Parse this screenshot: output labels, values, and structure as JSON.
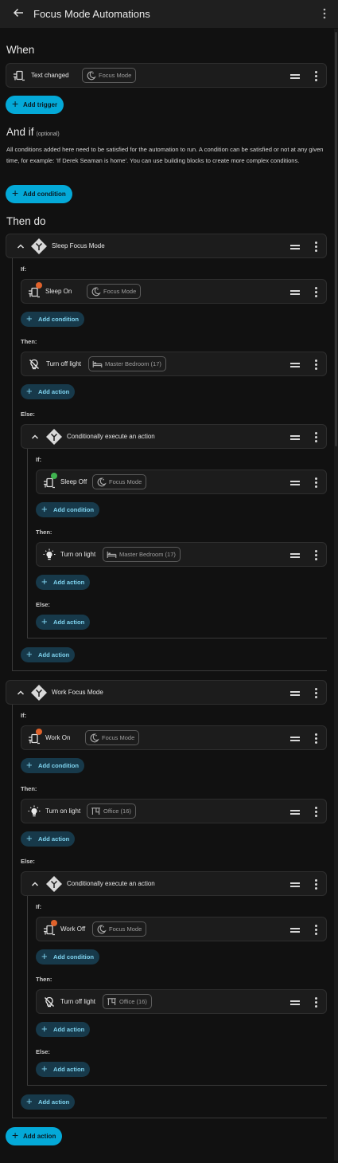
{
  "header": {
    "title": "Focus Mode Automations"
  },
  "when": {
    "heading": "When",
    "trigger": {
      "label": "Text changed",
      "chip": "Focus Mode"
    },
    "add_trigger": "Add trigger"
  },
  "and_if": {
    "heading": "And if",
    "optional": "(optional)",
    "description": "All conditions added here need to be satisfied for the automation to run. A condition can be satisfied or not at any given time, for example: 'If Derek Seaman is home'. You can use building blocks to create more complex conditions.",
    "add_condition": "Add condition"
  },
  "then_do": {
    "heading": "Then do",
    "add_action": "Add action"
  },
  "labels": {
    "if": "If:",
    "then": "Then:",
    "else": "Else:",
    "add_condition": "Add condition",
    "add_action": "Add action"
  },
  "sleep": {
    "title": "Sleep Focus Mode",
    "if_item": {
      "label": "Sleep On",
      "chip": "Focus Mode"
    },
    "then_item": {
      "label": "Turn off light",
      "chip": "Master Bedroom (17)"
    },
    "nested": {
      "title": "Conditionally execute an action",
      "if_item": {
        "label": "Sleep Off",
        "chip": "Focus Mode"
      },
      "then_item": {
        "label": "Turn on light",
        "chip": "Master Bedroom (17)"
      }
    }
  },
  "work": {
    "title": "Work Focus Mode",
    "if_item": {
      "label": "Work On",
      "chip": "Focus Mode"
    },
    "then_item": {
      "label": "Turn on light",
      "chip": "Office (16)"
    },
    "nested": {
      "title": "Conditionally execute an action",
      "if_item": {
        "label": "Work Off",
        "chip": "Focus Mode"
      },
      "then_item": {
        "label": "Turn off light",
        "chip": "Office (16)"
      }
    }
  },
  "colors": {
    "accent": "#04a9d8",
    "sub_button_bg": "#17394a",
    "badge_error": "#e0622b",
    "badge_ok": "#3fb24f"
  }
}
